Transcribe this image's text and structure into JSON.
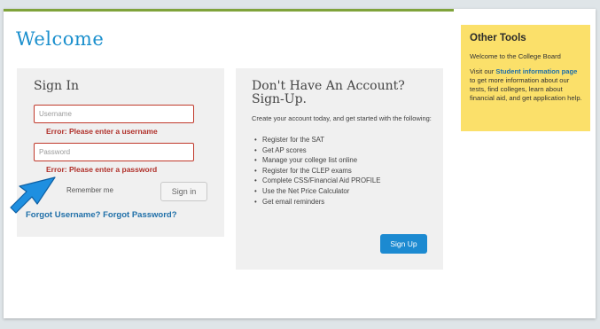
{
  "page": {
    "title": "Welcome"
  },
  "signin": {
    "heading": "Sign In",
    "username_placeholder": "Username",
    "username_error": "Error: Please enter a username",
    "password_placeholder": "Password",
    "password_error": "Error: Please enter a password",
    "remember_label": "Remember me",
    "button_label": "Sign in",
    "forgot_username": "Forgot Username?",
    "forgot_password": "Forgot Password?"
  },
  "signup": {
    "heading_line1": "Don't Have An Account?",
    "heading_line2": "Sign-Up.",
    "intro": "Create your account today, and get started with the following:",
    "benefits": [
      "Register for the SAT",
      "Get AP scores",
      "Manage your college list online",
      "Register for the CLEP exams",
      "Complete CSS/Financial Aid PROFILE",
      "Use the Net Price Calculator",
      "Get email reminders"
    ],
    "button_label": "Sign Up"
  },
  "other_tools": {
    "heading": "Other Tools",
    "welcome_text": "Welcome to the College Board",
    "visit_prefix": "Visit our",
    "link_text": "Student information page",
    "visit_suffix": "to get more information about our tests, find colleges, learn about financial aid, and get application help."
  },
  "colors": {
    "accent_green": "#7fa33a",
    "title_blue": "#1a8fcd",
    "error_red": "#b0302a",
    "link_blue": "#1f6fa8",
    "tools_yellow": "#fbe06a",
    "signup_blue": "#1c8ad1",
    "arrow_blue": "#1e8fe0"
  },
  "icons": {
    "pointer": "arrow-pointer-icon"
  }
}
